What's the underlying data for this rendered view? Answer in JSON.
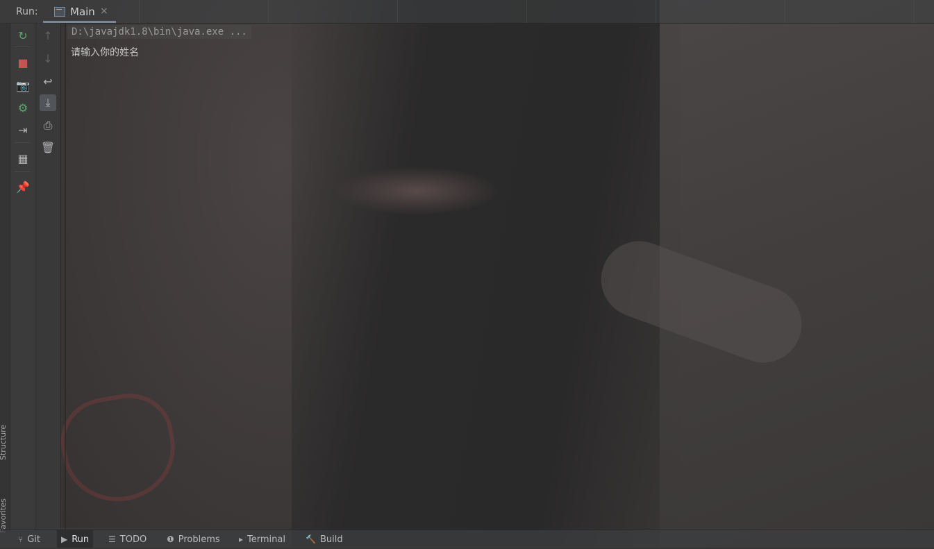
{
  "run_panel": {
    "label": "Run:",
    "tab": {
      "title": "Main",
      "close": "×"
    }
  },
  "toolbar_primary": [
    {
      "name": "rerun-icon",
      "glyph": "↻",
      "color": "#59a869"
    },
    {
      "name": "stop-icon",
      "glyph": "■",
      "color": "#c75450"
    },
    {
      "name": "camera-icon",
      "glyph": "📷",
      "color": "#afb1b3"
    },
    {
      "name": "restore-layout-icon",
      "glyph": "⚙",
      "color": "#59a869"
    },
    {
      "name": "exit-icon",
      "glyph": "⇥",
      "color": "#afb1b3"
    },
    {
      "name": "layout-icon",
      "glyph": "▦",
      "color": "#afb1b3"
    },
    {
      "name": "pin-icon",
      "glyph": "📌",
      "color": "#afb1b3"
    }
  ],
  "toolbar_secondary": [
    {
      "name": "up-arrow-icon",
      "glyph": "↑",
      "color": "#5e6060"
    },
    {
      "name": "down-arrow-icon",
      "glyph": "↓",
      "color": "#5e6060"
    },
    {
      "name": "soft-wrap-icon",
      "glyph": "↩",
      "color": "#afb1b3"
    },
    {
      "name": "scroll-to-end-icon",
      "glyph": "⤓",
      "color": "#afb1b3"
    },
    {
      "name": "print-icon",
      "glyph": "⎙",
      "color": "#afb1b3"
    },
    {
      "name": "trash-icon",
      "glyph": "🗑",
      "color": "#afb1b3"
    }
  ],
  "side_labels": {
    "structure": "Structure",
    "favorites": "Favorites"
  },
  "console": {
    "command": "D:\\javajdk1.8\\bin\\java.exe ...",
    "output": "请输入你的姓名"
  },
  "bottom_tabs": [
    {
      "label": "Git",
      "icon": "⑂",
      "active": false
    },
    {
      "label": "Run",
      "icon": "▶",
      "active": true
    },
    {
      "label": "TODO",
      "icon": "☰",
      "active": false
    },
    {
      "label": "Problems",
      "icon": "❶",
      "active": false
    },
    {
      "label": "Terminal",
      "icon": "▸",
      "active": false
    },
    {
      "label": "Build",
      "icon": "🔨",
      "active": false
    }
  ]
}
